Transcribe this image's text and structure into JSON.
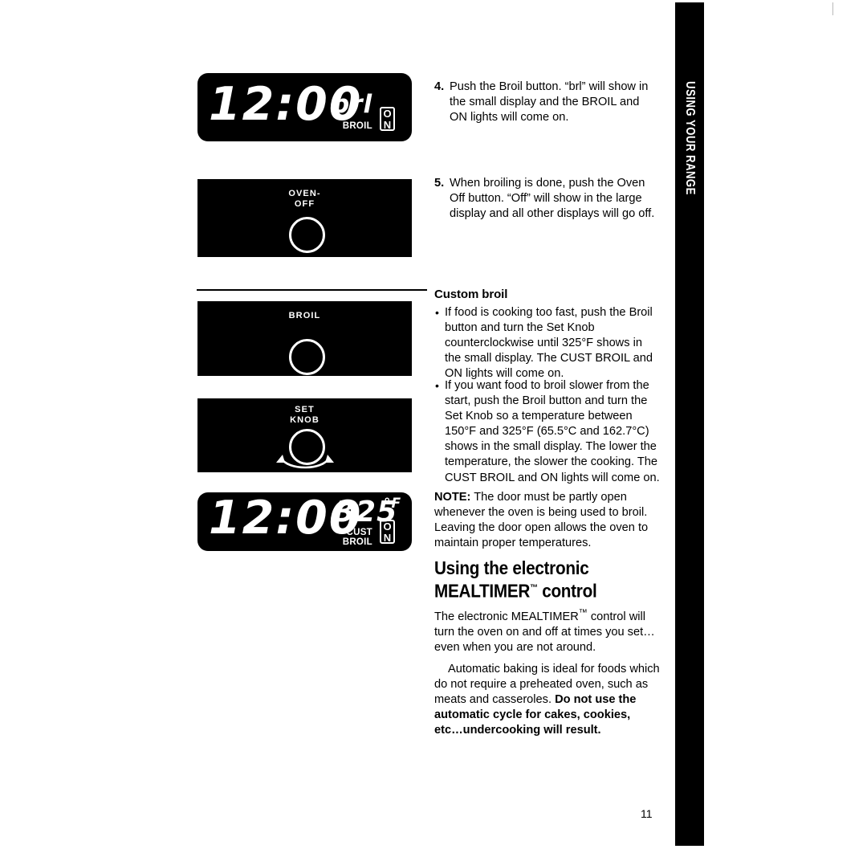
{
  "document": {
    "page_number": "11",
    "thumb_tab_label": "USING YOUR RANGE"
  },
  "displays": {
    "broil_display": {
      "name": "broil-display",
      "clock": "12:00",
      "small_display": "brl",
      "indicator_label": "BROIL",
      "on_lamp_top": "O",
      "on_lamp_bottom": "N"
    },
    "custom_broil_display": {
      "name": "custom-broil-display",
      "clock": "12:00",
      "small_display": "325",
      "degree_unit": "°F",
      "indicator_label_line1": "CUST",
      "indicator_label_line2": "BROIL",
      "on_lamp_top": "O",
      "on_lamp_bottom": "N"
    }
  },
  "buttons": {
    "oven_off": {
      "label_line1": "OVEN-",
      "label_line2": "OFF"
    },
    "broil": {
      "label_line1": "BROIL"
    },
    "set_knob": {
      "label_line1": "SET",
      "label_line2": "KNOB"
    }
  },
  "steps": [
    {
      "number": "4.",
      "text": "Push the Broil button. “brl” will show in the small display and the BROIL and ON lights will come on."
    },
    {
      "number": "5.",
      "text": "When broiling is done, push the Oven Off button. “Off” will show in the large display and all other displays will go off."
    }
  ],
  "custom_broil": {
    "heading": "Custom broil",
    "bullets": [
      "If food is cooking too fast, push the Broil button and turn the Set Knob counterclockwise until 325°F shows in the small display. The CUST BROIL and ON lights will come on.",
      "If you want food to broil slower from the start, push the Broil button and turn the Set Knob so a temperature between 150°F and 325°F (65.5°C and 162.7°C) shows in the small display. The lower the temperature, the slower the cooking. The CUST BROIL and ON lights will come on."
    ],
    "note_label": "NOTE:",
    "note_text": " The door must be partly open whenever the oven is being used to broil. Leaving the door open allows the oven to maintain proper temperatures."
  },
  "mealtimer": {
    "title_line1": "Using the electronic",
    "title_line2_a": "MEALTIMER",
    "title_trademark": "™",
    "title_line2_b": " control",
    "para1_a": "The electronic MEALTIMER",
    "para1_tm": "™",
    "para1_b": " control will turn the oven on and off at times you set…even when you are not around.",
    "para2_normal": "Automatic baking is ideal for foods which do not require a preheated oven, such as meats and casseroles. ",
    "para2_bold": "Do not use the automatic cycle for cakes, cookies, etc…undercooking will result."
  }
}
